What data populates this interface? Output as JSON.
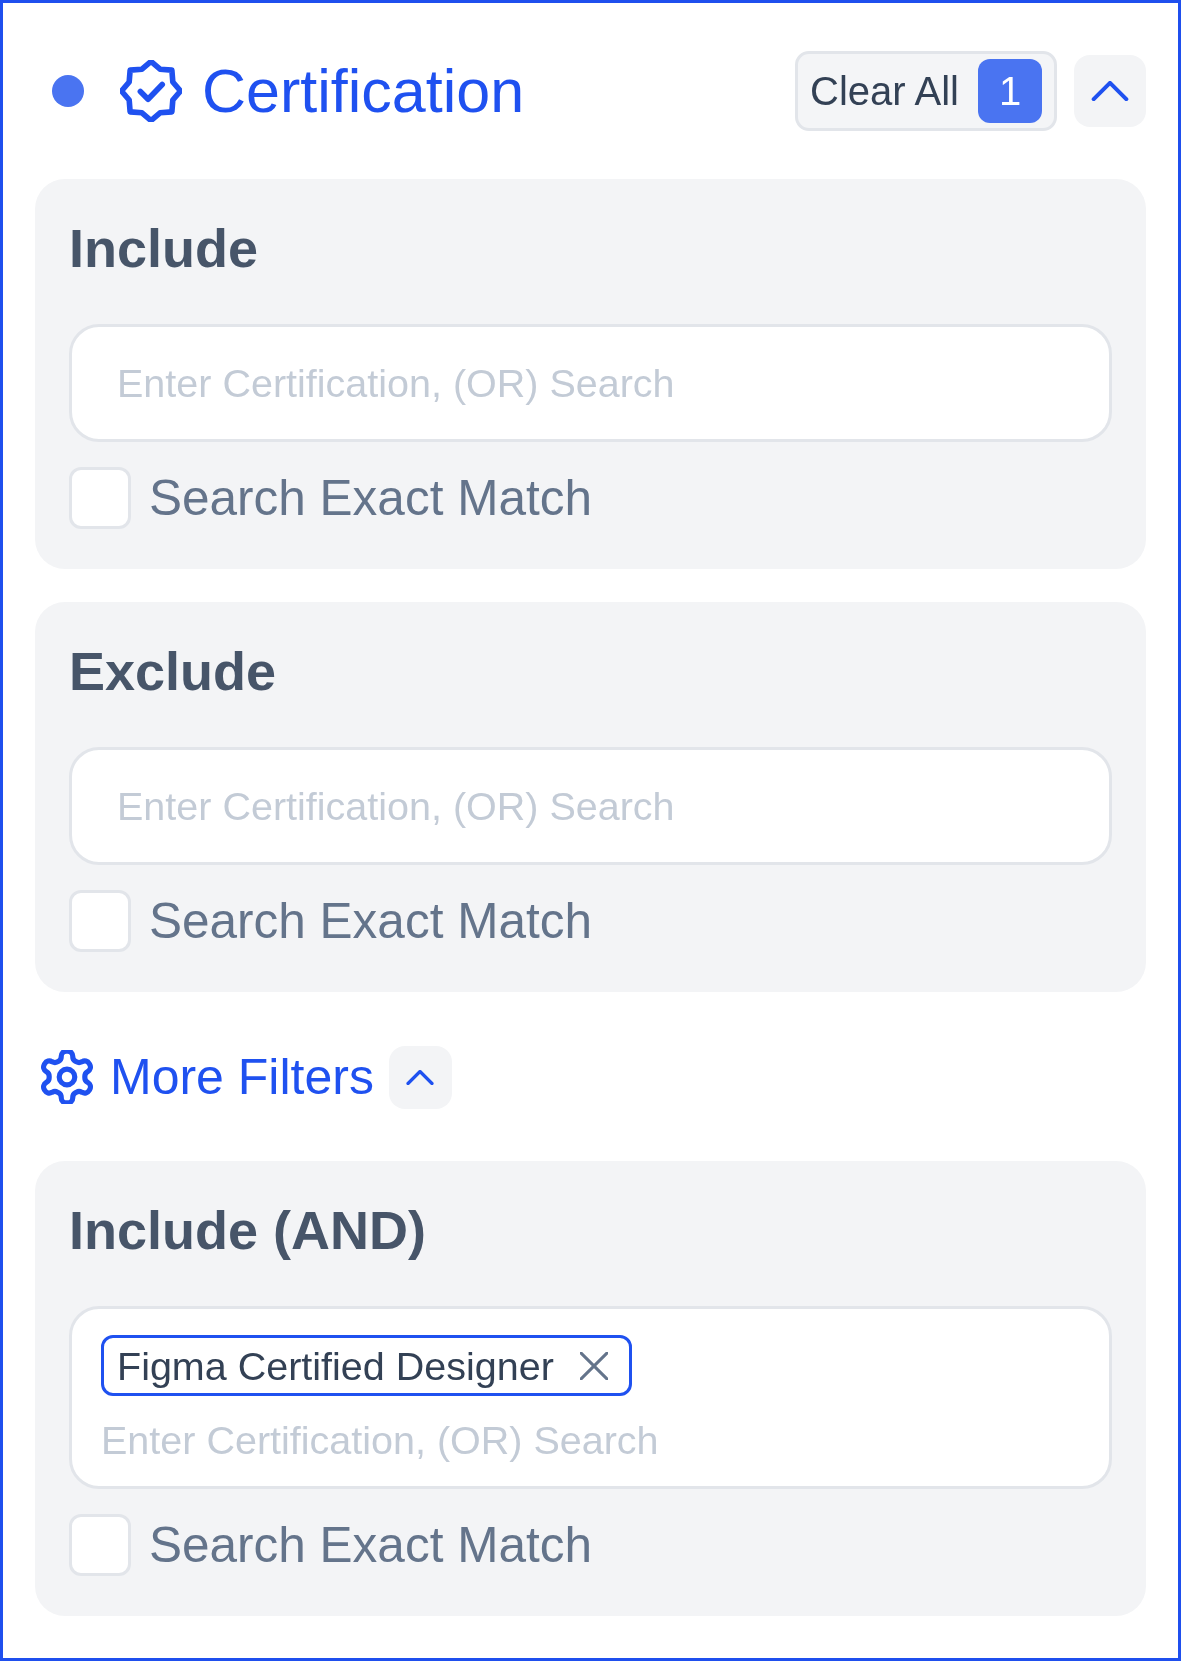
{
  "header": {
    "active": true,
    "title": "Certification",
    "clear_all": {
      "label": "Clear All",
      "count": "1"
    },
    "expanded": true
  },
  "sections": [
    {
      "title": "Include",
      "search": {
        "placeholder": "Enter Certification, (OR) Search"
      },
      "exact_match": {
        "label": "Search Exact Match",
        "checked": false
      }
    },
    {
      "title": "Exclude",
      "search": {
        "placeholder": "Enter Certification, (OR) Search"
      },
      "exact_match": {
        "label": "Search Exact Match",
        "checked": false
      }
    }
  ],
  "more_filters": {
    "label": "More Filters",
    "expanded": true
  },
  "more_sections": [
    {
      "title": "Include (AND)",
      "search": {
        "tags": [
          {
            "label": "Figma Certified Designer"
          }
        ],
        "placeholder": "Enter Certification, (OR) Search"
      },
      "exact_match": {
        "label": "Search Exact Match",
        "checked": false
      }
    }
  ]
}
